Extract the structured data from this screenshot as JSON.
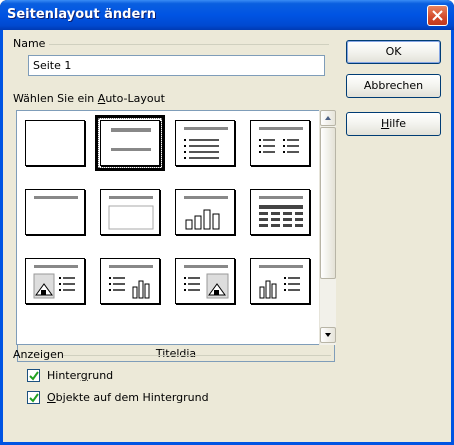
{
  "window": {
    "title": "Seitenlayout ändern"
  },
  "name_section": {
    "label": "Name",
    "value": "Seite 1"
  },
  "layout_section": {
    "label": "Wählen Sie ein Auto-Layout",
    "selected_caption": "Titeldia"
  },
  "layouts": [
    {
      "name": "Leeres Dia",
      "icon": "blank-layout-icon"
    },
    {
      "name": "Titeldia",
      "icon": "title-slide-layout-icon",
      "selected": true
    },
    {
      "name": "Titel, Text",
      "icon": "title-text-layout-icon"
    },
    {
      "name": "Titel, Text, Text",
      "icon": "title-two-text-layout-icon"
    },
    {
      "name": "Nur Titel",
      "icon": "title-only-layout-icon"
    },
    {
      "name": "Titel, Inhalt",
      "icon": "title-content-layout-icon"
    },
    {
      "name": "Titel, Diagramm",
      "icon": "title-chart-layout-icon"
    },
    {
      "name": "Titel, Tabelle",
      "icon": "title-table-layout-icon"
    },
    {
      "name": "Titel, Bild, Text",
      "icon": "title-image-text-layout-icon"
    },
    {
      "name": "Titel, Text, Diagramm",
      "icon": "title-text-chart-layout-icon"
    },
    {
      "name": "Titel, Text, Bild",
      "icon": "title-text-image-layout-icon"
    },
    {
      "name": "Titel, Diagramm, Text",
      "icon": "title-chart-text-layout-icon"
    }
  ],
  "buttons": {
    "ok": "OK",
    "cancel": "Abbrechen",
    "help": "Hilfe"
  },
  "display_section": {
    "label": "Anzeigen",
    "background": {
      "label": "Hintergrund",
      "checked": true
    },
    "background_objects": {
      "label": "Objekte auf dem Hintergrund",
      "checked": true
    }
  },
  "colors": {
    "titlebar": "#0054e3",
    "dialog_bg": "#ece9d8",
    "close_button": "#d3492b"
  }
}
